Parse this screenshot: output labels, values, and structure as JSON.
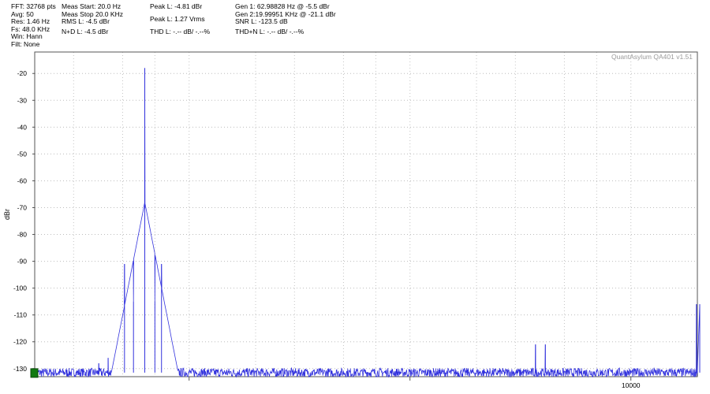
{
  "header": {
    "col1": [
      "FFT: 32768 pts",
      "Avg: 50",
      "Res: 1.46 Hz",
      "Fs: 48.0 KHz",
      "Win: Hann",
      "Filt: None"
    ],
    "col2a": [
      "Meas Start: 20.0 Hz",
      "Meas Stop 20.0 KHz",
      "RMS L: -4.5 dBr"
    ],
    "col2b": [
      "N+D L: -4.5 dBr"
    ],
    "col3a": [
      "Peak L: -4.81 dBr"
    ],
    "col3b": [
      "Peak L: 1.27 Vrms"
    ],
    "col3c": [
      "THD L: -.-- dB/ -.--%"
    ],
    "col4a": [
      "Gen 1: 62.98828 Hz @ -5.5  dBr",
      "Gen 2:19.99951 KHz @ -21.1  dBr",
      "SNR L: -123.5 dB"
    ],
    "col4b": [
      "THD+N L: -.-- dB/ -.--%"
    ]
  },
  "watermark": "QuantAsylum QA401 v1.51",
  "chart_data": {
    "type": "line",
    "title": "",
    "xlabel": "",
    "ylabel": "dBr",
    "xscale": "log",
    "xlim": [
      20,
      20000
    ],
    "ylim": [
      -133,
      -12
    ],
    "yticks": [
      -20,
      -30,
      -40,
      -50,
      -60,
      -70,
      -80,
      -90,
      -100,
      -110,
      -120,
      -130
    ],
    "xticks": [
      {
        "value": 10000,
        "label": "10000"
      }
    ],
    "grid": true,
    "grid_style": "dotted",
    "series": [
      {
        "color": "#3333dd",
        "noise_floor_db": -131.5,
        "peaks": [
          {
            "x": 63,
            "y": -18
          },
          {
            "x": 51,
            "y": -91
          },
          {
            "x": 56,
            "y": -105
          },
          {
            "x": 70,
            "y": -105
          },
          {
            "x": 75,
            "y": -91
          },
          {
            "x": 43,
            "y": -126
          },
          {
            "x": 39,
            "y": -128
          },
          {
            "x": 3700,
            "y": -121
          },
          {
            "x": 4100,
            "y": -121
          },
          {
            "x": 19800,
            "y": -106
          },
          {
            "x": 20500,
            "y": -106
          }
        ]
      }
    ]
  }
}
